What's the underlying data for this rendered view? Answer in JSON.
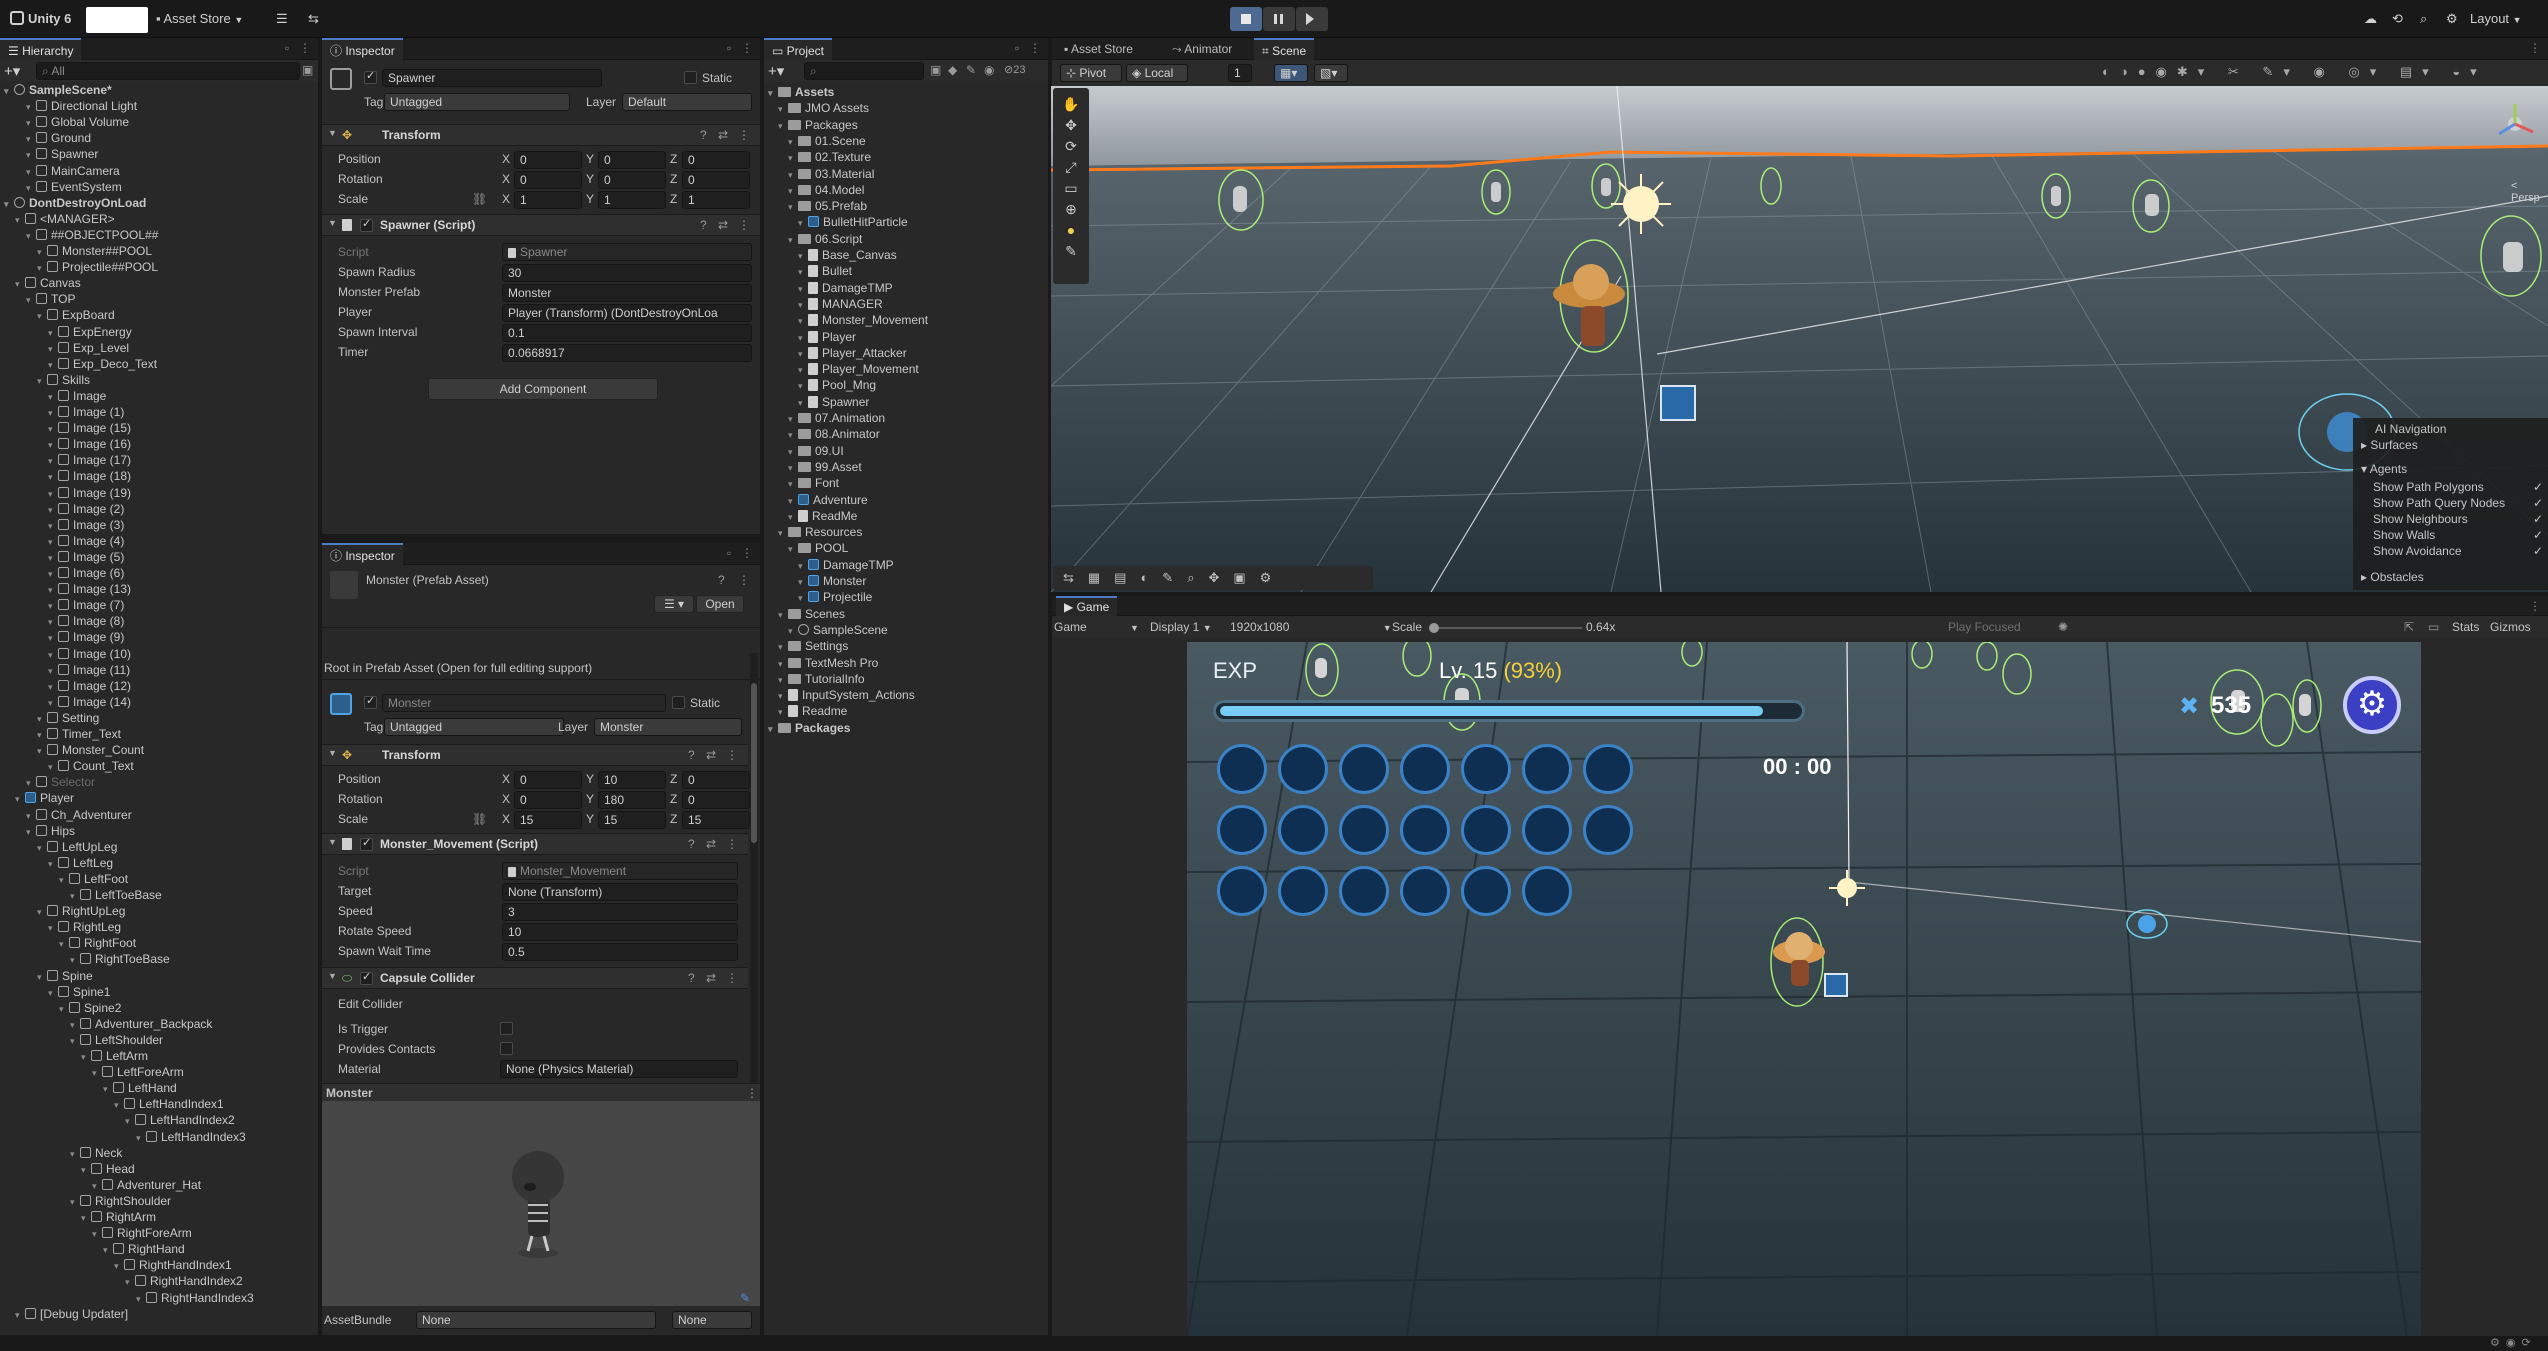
{
  "topbar": {
    "version": "Unity 6",
    "asset_store": "Asset Store",
    "layout": "Layout"
  },
  "hierarchy": {
    "title": "Hierarchy",
    "search": "All",
    "rows": [
      {
        "label": "SampleScene*",
        "depth": 0,
        "icon": "scene",
        "bold": true
      },
      {
        "label": "Directional Light",
        "depth": 2,
        "icon": "cube"
      },
      {
        "label": "Global Volume",
        "depth": 2,
        "icon": "cube"
      },
      {
        "label": "Ground",
        "depth": 2,
        "icon": "cube"
      },
      {
        "label": "Spawner",
        "depth": 2,
        "icon": "cube"
      },
      {
        "label": "MainCamera",
        "depth": 2,
        "icon": "cube"
      },
      {
        "label": "EventSystem",
        "depth": 2,
        "icon": "cube"
      },
      {
        "label": "DontDestroyOnLoad",
        "depth": 0,
        "icon": "scene",
        "bold": true
      },
      {
        "label": "<MANAGER>",
        "depth": 1,
        "icon": "cube"
      },
      {
        "label": "##OBJECTPOOL##",
        "depth": 2,
        "icon": "cube"
      },
      {
        "label": "Monster##POOL",
        "depth": 3,
        "icon": "cube"
      },
      {
        "label": "Projectile##POOL",
        "depth": 3,
        "icon": "cube"
      },
      {
        "label": "Canvas",
        "depth": 1,
        "icon": "cube"
      },
      {
        "label": "TOP",
        "depth": 2,
        "icon": "cube"
      },
      {
        "label": "ExpBoard",
        "depth": 3,
        "icon": "cube"
      },
      {
        "label": "ExpEnergy",
        "depth": 4,
        "icon": "cube"
      },
      {
        "label": "Exp_Level",
        "depth": 4,
        "icon": "cube"
      },
      {
        "label": "Exp_Deco_Text",
        "depth": 4,
        "icon": "cube"
      },
      {
        "label": "Skills",
        "depth": 3,
        "icon": "cube"
      },
      {
        "label": "Image",
        "depth": 4,
        "icon": "cube"
      },
      {
        "label": "Image (1)",
        "depth": 4,
        "icon": "cube"
      },
      {
        "label": "Image (15)",
        "depth": 4,
        "icon": "cube"
      },
      {
        "label": "Image (16)",
        "depth": 4,
        "icon": "cube"
      },
      {
        "label": "Image (17)",
        "depth": 4,
        "icon": "cube"
      },
      {
        "label": "Image (18)",
        "depth": 4,
        "icon": "cube"
      },
      {
        "label": "Image (19)",
        "depth": 4,
        "icon": "cube"
      },
      {
        "label": "Image (2)",
        "depth": 4,
        "icon": "cube"
      },
      {
        "label": "Image (3)",
        "depth": 4,
        "icon": "cube"
      },
      {
        "label": "Image (4)",
        "depth": 4,
        "icon": "cube"
      },
      {
        "label": "Image (5)",
        "depth": 4,
        "icon": "cube"
      },
      {
        "label": "Image (6)",
        "depth": 4,
        "icon": "cube"
      },
      {
        "label": "Image (13)",
        "depth": 4,
        "icon": "cube"
      },
      {
        "label": "Image (7)",
        "depth": 4,
        "icon": "cube"
      },
      {
        "label": "Image (8)",
        "depth": 4,
        "icon": "cube"
      },
      {
        "label": "Image (9)",
        "depth": 4,
        "icon": "cube"
      },
      {
        "label": "Image (10)",
        "depth": 4,
        "icon": "cube"
      },
      {
        "label": "Image (11)",
        "depth": 4,
        "icon": "cube"
      },
      {
        "label": "Image (12)",
        "depth": 4,
        "icon": "cube"
      },
      {
        "label": "Image (14)",
        "depth": 4,
        "icon": "cube"
      },
      {
        "label": "Setting",
        "depth": 3,
        "icon": "cube"
      },
      {
        "label": "Timer_Text",
        "depth": 3,
        "icon": "cube"
      },
      {
        "label": "Monster_Count",
        "depth": 3,
        "icon": "cube"
      },
      {
        "label": "Count_Text",
        "depth": 4,
        "icon": "cube"
      },
      {
        "label": "Selector",
        "depth": 2,
        "icon": "cube",
        "dim": true
      },
      {
        "label": "Player",
        "depth": 1,
        "icon": "blue"
      },
      {
        "label": "Ch_Adventurer",
        "depth": 2,
        "icon": "cube"
      },
      {
        "label": "Hips",
        "depth": 2,
        "icon": "cube"
      },
      {
        "label": "LeftUpLeg",
        "depth": 3,
        "icon": "cube"
      },
      {
        "label": "LeftLeg",
        "depth": 4,
        "icon": "cube"
      },
      {
        "label": "LeftFoot",
        "depth": 5,
        "icon": "cube"
      },
      {
        "label": "LeftToeBase",
        "depth": 6,
        "icon": "cube"
      },
      {
        "label": "RightUpLeg",
        "depth": 3,
        "icon": "cube"
      },
      {
        "label": "RightLeg",
        "depth": 4,
        "icon": "cube"
      },
      {
        "label": "RightFoot",
        "depth": 5,
        "icon": "cube"
      },
      {
        "label": "RightToeBase",
        "depth": 6,
        "icon": "cube"
      },
      {
        "label": "Spine",
        "depth": 3,
        "icon": "cube"
      },
      {
        "label": "Spine1",
        "depth": 4,
        "icon": "cube"
      },
      {
        "label": "Spine2",
        "depth": 5,
        "icon": "cube"
      },
      {
        "label": "Adventurer_Backpack",
        "depth": 6,
        "icon": "cube"
      },
      {
        "label": "LeftShoulder",
        "depth": 6,
        "icon": "cube"
      },
      {
        "label": "LeftArm",
        "depth": 7,
        "icon": "cube"
      },
      {
        "label": "LeftForeArm",
        "depth": 8,
        "icon": "cube"
      },
      {
        "label": "LeftHand",
        "depth": 9,
        "icon": "cube"
      },
      {
        "label": "LeftHandIndex1",
        "depth": 10,
        "icon": "cube"
      },
      {
        "label": "LeftHandIndex2",
        "depth": 11,
        "icon": "cube"
      },
      {
        "label": "LeftHandIndex3",
        "depth": 12,
        "icon": "cube"
      },
      {
        "label": "Neck",
        "depth": 6,
        "icon": "cube"
      },
      {
        "label": "Head",
        "depth": 7,
        "icon": "cube"
      },
      {
        "label": "Adventurer_Hat",
        "depth": 8,
        "icon": "cube"
      },
      {
        "label": "RightShoulder",
        "depth": 6,
        "icon": "cube"
      },
      {
        "label": "RightArm",
        "depth": 7,
        "icon": "cube"
      },
      {
        "label": "RightForeArm",
        "depth": 8,
        "icon": "cube"
      },
      {
        "label": "RightHand",
        "depth": 9,
        "icon": "cube"
      },
      {
        "label": "RightHandIndex1",
        "depth": 10,
        "icon": "cube"
      },
      {
        "label": "RightHandIndex2",
        "depth": 11,
        "icon": "cube"
      },
      {
        "label": "RightHandIndex3",
        "depth": 12,
        "icon": "cube"
      },
      {
        "label": "[Debug Updater]",
        "depth": 1,
        "icon": "cube"
      }
    ]
  },
  "inspector1": {
    "title": "Inspector",
    "object_name": "Spawner",
    "static": "Static",
    "tag_label": "Tag",
    "tag": "Untagged",
    "layer_label": "Layer",
    "layer": "Default",
    "transform": {
      "title": "Transform",
      "position": "Position",
      "rotation": "Rotation",
      "scale": "Scale",
      "pos": [
        "0",
        "0",
        "0"
      ],
      "rot": [
        "0",
        "0",
        "0"
      ],
      "scl": [
        "1",
        "1",
        "1"
      ]
    },
    "spawner": {
      "title": "Spawner (Script)",
      "script_label": "Script",
      "script": "Spawner",
      "rows": [
        {
          "label": "Spawn Radius",
          "value": "30"
        },
        {
          "label": "Monster Prefab",
          "value": "Monster"
        },
        {
          "label": "Player",
          "value": "Player (Transform) (DontDestroyOnLoa"
        },
        {
          "label": "Spawn Interval",
          "value": "0.1"
        },
        {
          "label": "Timer",
          "value": "0.0668917"
        }
      ]
    },
    "add_component": "Add Component"
  },
  "inspector2": {
    "title": "Inspector",
    "asset_title": "Monster (Prefab Asset)",
    "open": "Open",
    "root_note": "Root in Prefab Asset (Open for full editing support)",
    "object_name": "Monster",
    "static": "Static",
    "tag_label": "Tag",
    "tag": "Untagged",
    "layer_label": "Layer",
    "layer": "Monster",
    "transform": {
      "title": "Transform",
      "position": "Position",
      "rotation": "Rotation",
      "scale": "Scale",
      "pos": [
        "0",
        "10",
        "0"
      ],
      "rot": [
        "0",
        "180",
        "0"
      ],
      "scl": [
        "15",
        "15",
        "15"
      ]
    },
    "movement": {
      "title": "Monster_Movement (Script)",
      "script_label": "Script",
      "script": "Monster_Movement",
      "rows": [
        {
          "label": "Target",
          "value": "None (Transform)"
        },
        {
          "label": "Speed",
          "value": "3"
        },
        {
          "label": "Rotate Speed",
          "value": "10"
        },
        {
          "label": "Spawn Wait Time",
          "value": "0.5"
        }
      ]
    },
    "collider": {
      "title": "Capsule Collider",
      "edit": "Edit Collider",
      "is_trigger": "Is Trigger",
      "provides_contacts": "Provides Contacts",
      "material_label": "Material",
      "material": "None (Physics Material)"
    },
    "preview_title": "Monster",
    "assetbundle_label": "AssetBundle",
    "assetbundle": "None",
    "assetbundle2": "None"
  },
  "project": {
    "title": "Project",
    "count": "23",
    "rows": [
      {
        "label": "Assets",
        "depth": 0,
        "icon": "folder",
        "bold": true
      },
      {
        "label": "JMO Assets",
        "depth": 1,
        "icon": "folder"
      },
      {
        "label": "Packages",
        "depth": 1,
        "icon": "folder"
      },
      {
        "label": "01.Scene",
        "depth": 2,
        "icon": "folder"
      },
      {
        "label": "02.Texture",
        "depth": 2,
        "icon": "folder"
      },
      {
        "label": "03.Material",
        "depth": 2,
        "icon": "folder"
      },
      {
        "label": "04.Model",
        "depth": 2,
        "icon": "folder"
      },
      {
        "label": "05.Prefab",
        "depth": 2,
        "icon": "folder"
      },
      {
        "label": "BulletHitParticle",
        "depth": 3,
        "icon": "blue"
      },
      {
        "label": "06.Script",
        "depth": 2,
        "icon": "folder"
      },
      {
        "label": "Base_Canvas",
        "depth": 3,
        "icon": "script"
      },
      {
        "label": "Bullet",
        "depth": 3,
        "icon": "script"
      },
      {
        "label": "DamageTMP",
        "depth": 3,
        "icon": "script"
      },
      {
        "label": "MANAGER",
        "depth": 3,
        "icon": "script"
      },
      {
        "label": "Monster_Movement",
        "depth": 3,
        "icon": "script"
      },
      {
        "label": "Player",
        "depth": 3,
        "icon": "script"
      },
      {
        "label": "Player_Attacker",
        "depth": 3,
        "icon": "script"
      },
      {
        "label": "Player_Movement",
        "depth": 3,
        "icon": "script"
      },
      {
        "label": "Pool_Mng",
        "depth": 3,
        "icon": "script"
      },
      {
        "label": "Spawner",
        "depth": 3,
        "icon": "script"
      },
      {
        "label": "07.Animation",
        "depth": 2,
        "icon": "folder"
      },
      {
        "label": "08.Animator",
        "depth": 2,
        "icon": "folder"
      },
      {
        "label": "09.UI",
        "depth": 2,
        "icon": "folder"
      },
      {
        "label": "99.Asset",
        "depth": 2,
        "icon": "folder"
      },
      {
        "label": "Font",
        "depth": 2,
        "icon": "folder"
      },
      {
        "label": "Adventure",
        "depth": 2,
        "icon": "blue"
      },
      {
        "label": "ReadMe",
        "depth": 2,
        "icon": "script"
      },
      {
        "label": "Resources",
        "depth": 1,
        "icon": "folder"
      },
      {
        "label": "POOL",
        "depth": 2,
        "icon": "folder"
      },
      {
        "label": "DamageTMP",
        "depth": 3,
        "icon": "blue"
      },
      {
        "label": "Monster",
        "depth": 3,
        "icon": "blue"
      },
      {
        "label": "Projectile",
        "depth": 3,
        "icon": "blue"
      },
      {
        "label": "Scenes",
        "depth": 1,
        "icon": "folder"
      },
      {
        "label": "SampleScene",
        "depth": 2,
        "icon": "scene"
      },
      {
        "label": "Settings",
        "depth": 1,
        "icon": "folder"
      },
      {
        "label": "TextMesh Pro",
        "depth": 1,
        "icon": "folder"
      },
      {
        "label": "TutorialInfo",
        "depth": 1,
        "icon": "folder"
      },
      {
        "label": "InputSystem_Actions",
        "depth": 1,
        "icon": "script"
      },
      {
        "label": "Readme",
        "depth": 1,
        "icon": "script"
      },
      {
        "label": "Packages",
        "depth": 0,
        "icon": "folder",
        "bold": true
      }
    ]
  },
  "scene": {
    "tabs": [
      "Asset Store",
      "Animator",
      "Scene"
    ],
    "pivot": "Pivot",
    "local": "Local",
    "grid_step": "1",
    "persp": "< Persp",
    "nav_overlay": {
      "title": "AI Navigation",
      "surfaces": "Surfaces",
      "agents": "Agents",
      "items": [
        "Show Path Polygons",
        "Show Path Query Nodes",
        "Show Neighbours",
        "Show Walls",
        "Show Avoidance"
      ],
      "obstacles": "Obstacles"
    }
  },
  "game": {
    "tab": "Game",
    "mode": "Game",
    "display": "Display 1",
    "resolution": "1920x1080",
    "scale_label": "Scale",
    "scale_value": "0.64x",
    "play_focused": "Play Focused",
    "stats": "Stats",
    "gizmos": "Gizmos",
    "hud": {
      "exp_label": "EXP",
      "level": "Lv. 15",
      "percent": "(93%)",
      "exp_fill": 0.93,
      "timer": "00 : 00",
      "kill_count": "535",
      "skill_rows": [
        7,
        7,
        6
      ]
    }
  },
  "colors": {
    "accent": "#4c7dc9",
    "selection": "#2c5d87",
    "scene_highlight": "#ff7a1a",
    "hud_yellow": "#f5d038"
  }
}
